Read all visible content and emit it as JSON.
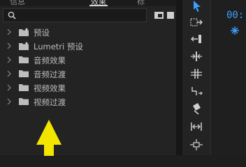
{
  "effects_panel": {
    "tabs": [
      {
        "label": "信息",
        "active": false
      },
      {
        "label": "效果",
        "active": true
      },
      {
        "label": "标",
        "active": false
      }
    ],
    "search": {
      "value": "",
      "placeholder": ""
    },
    "tree": [
      {
        "label": "预设",
        "icon": "star-folder-icon"
      },
      {
        "label": "Lumetri 预设",
        "icon": "star-folder-icon"
      },
      {
        "label": "音频效果",
        "icon": "folder-icon"
      },
      {
        "label": "音频过渡",
        "icon": "folder-icon"
      },
      {
        "label": "视频效果",
        "icon": "folder-icon"
      },
      {
        "label": "视频过渡",
        "icon": "folder-icon"
      }
    ]
  },
  "tools_panel": {
    "tools": [
      "selection-tool-icon",
      "track-select-forward-tool-icon",
      "ripple-edit-tool-icon",
      "rolling-edit-tool-icon",
      "rate-stretch-tool-icon",
      "slip-tool-icon",
      "razor-tool-icon",
      "hand-tool-icon",
      "type-tool-icon"
    ]
  },
  "timeline_panel": {
    "timecode": "00:"
  },
  "colors": {
    "accent": "#3aa0ff",
    "annotation_arrow": "#f2e600"
  }
}
